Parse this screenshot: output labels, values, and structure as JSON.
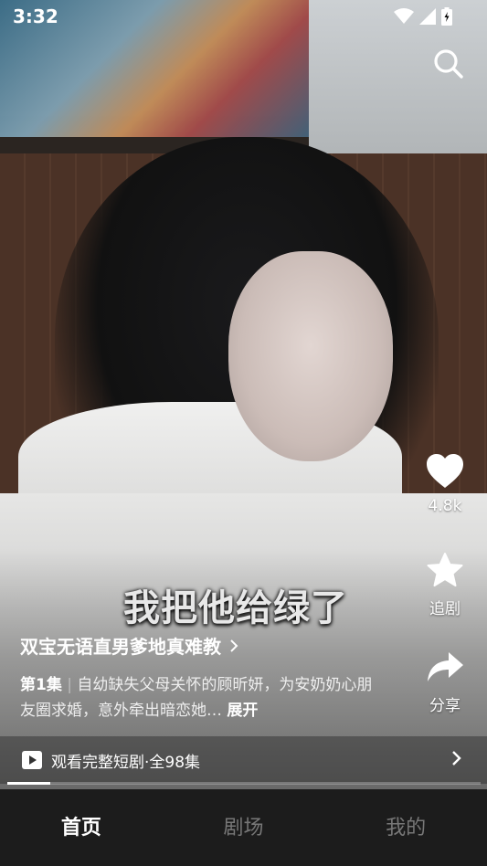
{
  "status_bar": {
    "time": "3:32"
  },
  "video": {
    "subtitle": "我把他给绿了",
    "progress": 0.09
  },
  "actions": {
    "like_count": "4.8k",
    "follow_label": "追剧",
    "share_label": "分享"
  },
  "drama": {
    "title": "双宝无语直男爹地真难教",
    "episode": "第1集",
    "separator": "|",
    "description": "自幼缺失父母关怀的顾昕妍，为安奶奶心朋友圈求婚，意外牵出暗恋她…",
    "expand_label": "展开",
    "watch_full_label": "观看完整短剧·全98集"
  },
  "nav": {
    "tabs": [
      {
        "label": "首页",
        "active": true
      },
      {
        "label": "剧场",
        "active": false
      },
      {
        "label": "我的",
        "active": false
      }
    ]
  },
  "icons": {
    "search": "search-icon",
    "like": "heart-icon",
    "follow": "star-icon",
    "share": "share-arrow-icon",
    "play": "play-icon",
    "chevron": "chevron-right-icon"
  }
}
